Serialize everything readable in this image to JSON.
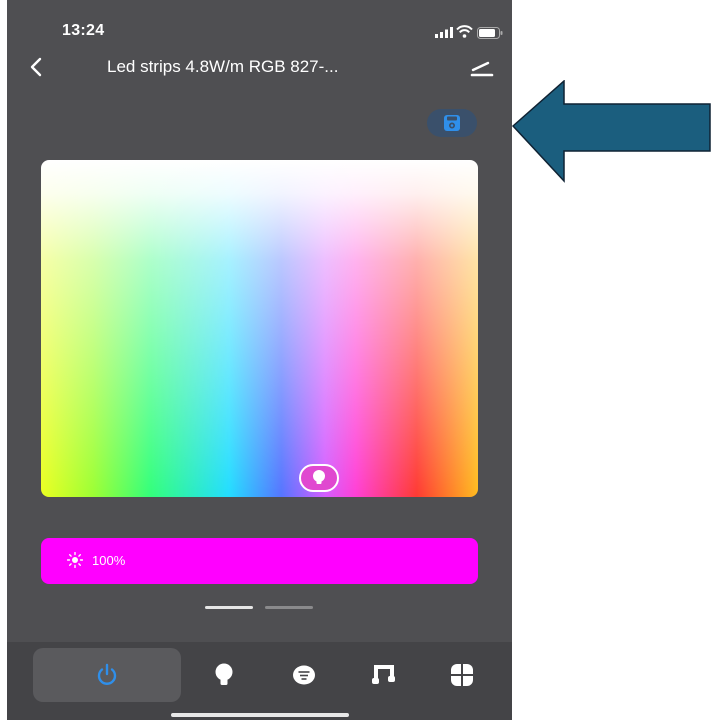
{
  "status_bar": {
    "time": "13:24"
  },
  "nav": {
    "title": "Led strips 4.8W/m RGB 827-...",
    "back_icon": "chevron-left-icon",
    "edit_icon": "pencil-icon"
  },
  "save": {
    "icon": "floppy-disk-icon"
  },
  "color_picker": {
    "handle_icon": "bulb-icon",
    "selected_color": "#e048d0"
  },
  "brightness": {
    "value_label": "100%",
    "level_percent": 100,
    "bar_color": "#ff00ff",
    "icon": "sun-icon"
  },
  "page_indicator": {
    "pages": 2,
    "current": 1
  },
  "tabs": [
    {
      "name": "power",
      "icon": "power-icon",
      "active": true
    },
    {
      "name": "white",
      "icon": "bulb-icon",
      "active": false
    },
    {
      "name": "scene",
      "icon": "scene-icon",
      "active": false
    },
    {
      "name": "music",
      "icon": "music-icon",
      "active": false
    },
    {
      "name": "more",
      "icon": "grid-icon",
      "active": false
    }
  ],
  "colors": {
    "app_background": "#4f4f52",
    "tab_bar": "#444447",
    "accent": "#2f8fea",
    "annotation_arrow": "#1b5e7e"
  }
}
